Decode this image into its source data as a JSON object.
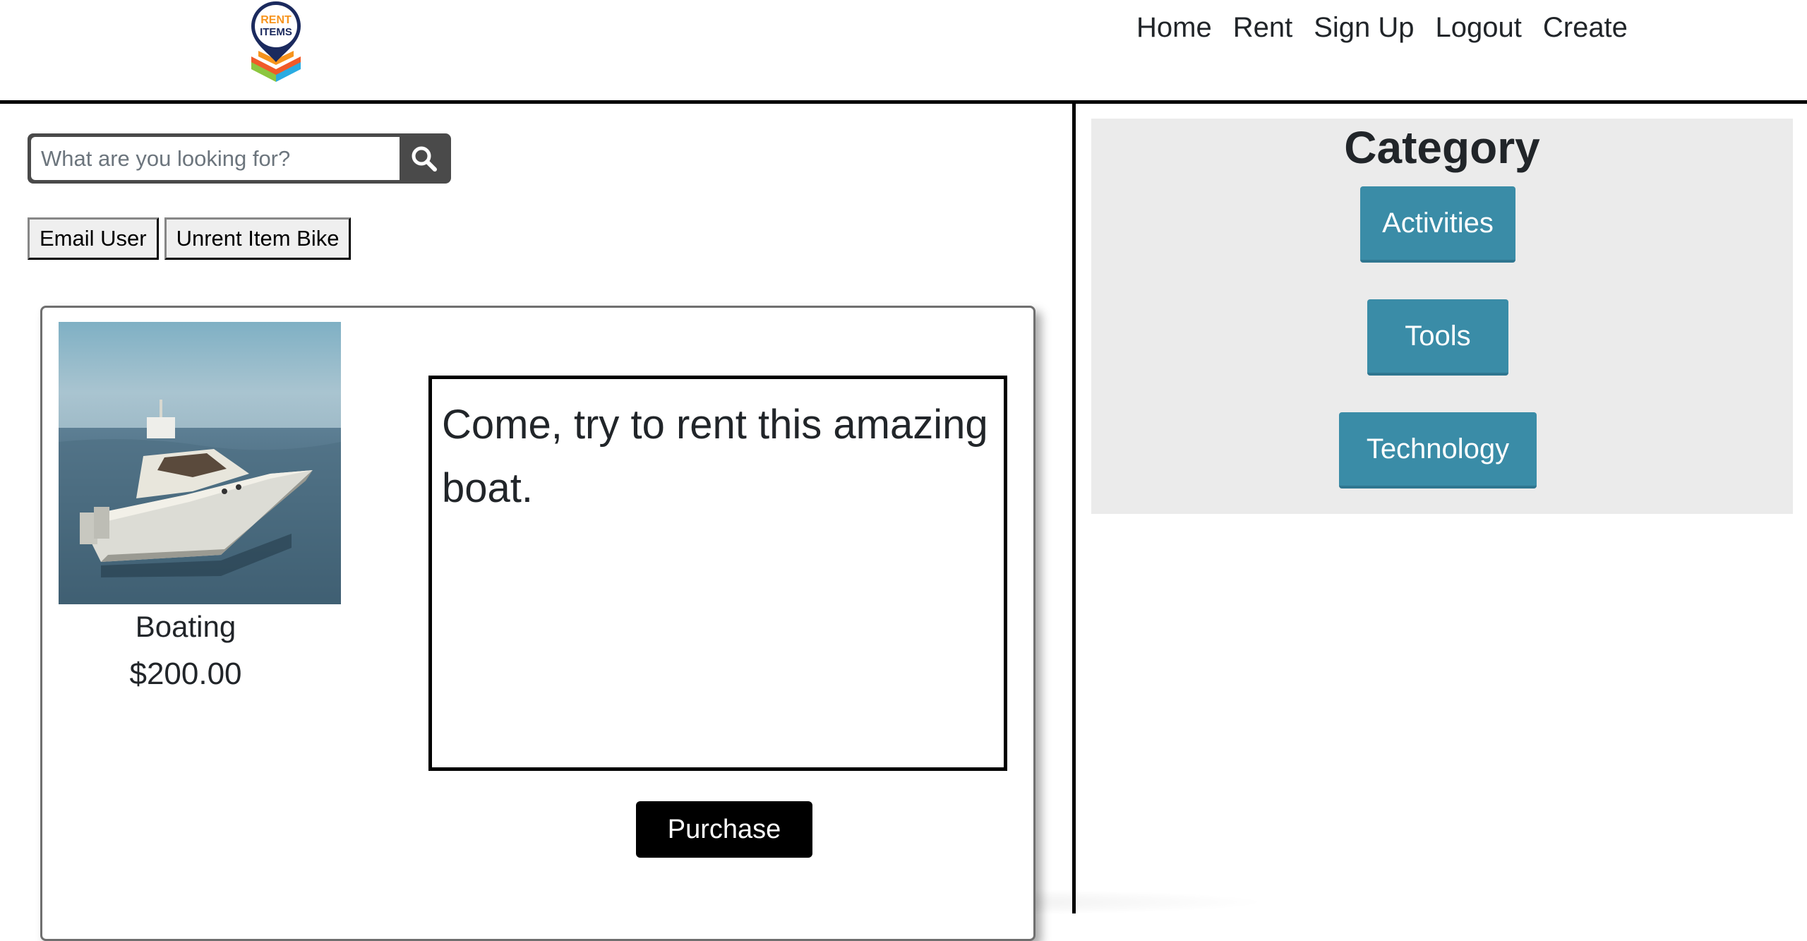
{
  "header": {
    "logo_text": "RENT ITEMS",
    "nav": [
      {
        "label": "Home"
      },
      {
        "label": "Rent"
      },
      {
        "label": "Sign Up"
      },
      {
        "label": "Logout"
      },
      {
        "label": "Create"
      }
    ]
  },
  "search": {
    "placeholder": "What are you looking for?",
    "value": "",
    "icon": "search-icon"
  },
  "actions": {
    "email_user_label": "Email User",
    "unrent_label": "Unrent Item Bike"
  },
  "item": {
    "name": "Boating",
    "price": "$200.00",
    "description": "Come, try to rent this amazing boat.",
    "purchase_label": "Purchase"
  },
  "category": {
    "title": "Category",
    "items": [
      {
        "label": "Activities"
      },
      {
        "label": "Tools"
      },
      {
        "label": "Technology"
      }
    ]
  },
  "colors": {
    "category_button": "#3a8ca7",
    "category_panel": "#ebebeb",
    "purchase_button": "#000000"
  }
}
